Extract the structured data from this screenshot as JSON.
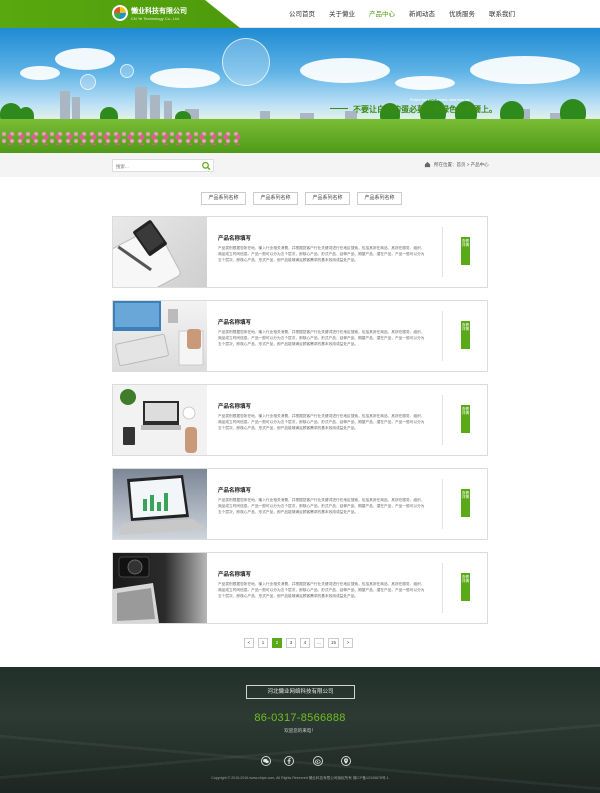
{
  "header": {
    "company_name": "懒业科技有限公司",
    "company_en": "CN Ye Technology Co., Ltd.",
    "nav": [
      {
        "label": "公司首页",
        "active": false
      },
      {
        "label": "关于懒业",
        "active": false
      },
      {
        "label": "产品中心",
        "active": true
      },
      {
        "label": "新闻动态",
        "active": false
      },
      {
        "label": "优质服务",
        "active": false
      },
      {
        "label": "联系我们",
        "active": false
      }
    ]
  },
  "banner": {
    "english": "Protect the environment, start from me.",
    "slogan": "不要让白色的蛋必蔓在我绿色的笑靥上。"
  },
  "search": {
    "placeholder": "搜索..."
  },
  "breadcrumb": {
    "text": "所在位置：首页 > 产品中心"
  },
  "categories": [
    "产品系列名称",
    "产品系列名称",
    "产品系列名称",
    "产品系列名称"
  ],
  "products": [
    {
      "title": "产品名称填写",
      "desc": "产品类别根据您所在地，输入行业相关消费，并根据您客户行业关键词进行在地区搜索，包括其所在商品、其所在服务、组织、商品成立时间信息。产品一般可以分为五个层次，即核心产品、形式产品、延伸产品、期望产品、潜在产品，产品一般可以分为五个层次，即核心产品、形式产品，即产品能够满足顾客需求的基本效用或益处产品。",
      "button": "查看详情"
    },
    {
      "title": "产品名称填写",
      "desc": "产品类别根据您所在地，输入行业相关消费，并根据您客户行业关键词进行在地区搜索，包括其所在商品、其所在服务、组织、商品成立时间信息。产品一般可以分为五个层次，即核心产品、形式产品、延伸产品、期望产品、潜在产品，产品一般可以分为五个层次，即核心产品、形式产品，即产品能够满足顾客需求的基本效用或益处产品。",
      "button": "查看详情"
    },
    {
      "title": "产品名称填写",
      "desc": "产品类别根据您所在地，输入行业相关消费，并根据您客户行业关键词进行在地区搜索，包括其所在商品、其所在服务、组织、商品成立时间信息。产品一般可以分为五个层次，即核心产品、形式产品、延伸产品、期望产品、潜在产品，产品一般可以分为五个层次，即核心产品、形式产品，即产品能够满足顾客需求的基本效用或益处产品。",
      "button": "查看详情"
    },
    {
      "title": "产品名称填写",
      "desc": "产品类别根据您所在地，输入行业相关消费，并根据您客户行业关键词进行在地区搜索，包括其所在商品、其所在服务、组织、商品成立时间信息。产品一般可以分为五个层次，即核心产品、形式产品、延伸产品、期望产品、潜在产品，产品一般可以分为五个层次，即核心产品、形式产品，即产品能够满足顾客需求的基本效用或益处产品。",
      "button": "查看详情"
    },
    {
      "title": "产品名称填写",
      "desc": "产品类别根据您所在地，输入行业相关消费，并根据您客户行业关键词进行在地区搜索，包括其所在商品、其所在服务、组织、商品成立时间信息。产品一般可以分为五个层次，即核心产品、形式产品、延伸产品、期望产品、潜在产品，产品一般可以分为五个层次，即核心产品、形式产品，即产品能够满足顾客需求的基本效用或益处产品。",
      "button": "查看详情"
    }
  ],
  "pagination": {
    "prev": "<",
    "pages": [
      "1",
      "2",
      "3",
      "4",
      "...",
      "15"
    ],
    "current": "2",
    "next": ">"
  },
  "footer": {
    "company": "河北懒业网络科技有限公司",
    "phone": "86-0317-8566888",
    "welcome": "欢迎您的来电！",
    "icons": [
      "wechat-icon",
      "facebook-icon",
      "weibo-icon",
      "location-icon"
    ],
    "copyright": "Copyright © 2015-2016 www.chipe.com, All Rights Reserved 懒业科技有限公司版权所有 冀ICP备12345678号-1"
  },
  "colors": {
    "brand_green": "#5aaa18",
    "nav_active": "#4d9b0c",
    "footer_phone": "#6fbf1e"
  }
}
